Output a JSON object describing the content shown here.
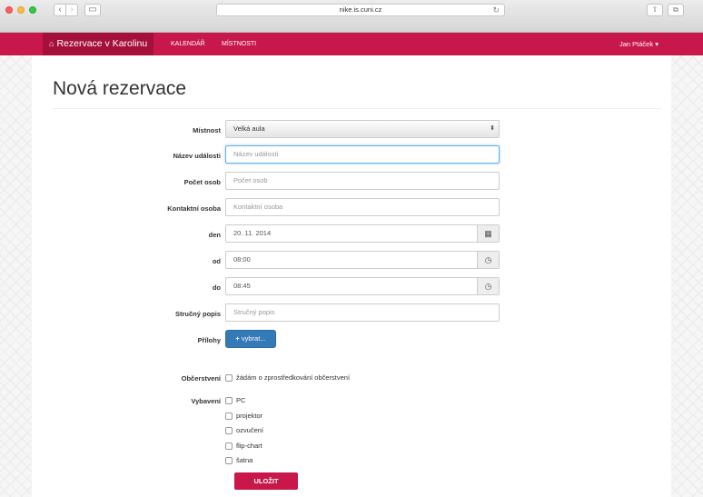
{
  "browser": {
    "url": "nike.is.cuni.cz",
    "back_icon": "chevron-left-icon",
    "forward_icon": "chevron-right-icon"
  },
  "navbar": {
    "brand": "Rezervace v Karolinu",
    "links": [
      "KALENDÁŘ",
      "MÍSTNOSTI"
    ],
    "user": "Jan Ptáček ▾",
    "color": "#c8174a"
  },
  "page": {
    "title": "Nová rezervace"
  },
  "form": {
    "room": {
      "label": "Místnost",
      "value": "Velká aula"
    },
    "event_name": {
      "label": "Název události",
      "placeholder": "Název události"
    },
    "people": {
      "label": "Počet osob",
      "placeholder": "Počet osob"
    },
    "contact": {
      "label": "Kontaktní osoba",
      "placeholder": "Kontaktní osoba"
    },
    "day": {
      "label": "den",
      "value": "20. 11. 2014"
    },
    "from": {
      "label": "od",
      "value": "08:00"
    },
    "to": {
      "label": "do",
      "value": "08:45"
    },
    "description": {
      "label": "Stručný popis",
      "placeholder": "Stručný popis"
    },
    "attachments": {
      "label": "Přílohy",
      "button": "vybrat..."
    },
    "refreshment": {
      "label": "Občerstvení",
      "option": "žádám o zprostředkování občerstvení"
    },
    "equipment": {
      "label": "Vybavení",
      "options": [
        "PC",
        "projektor",
        "ozvučení",
        "flip-chart",
        "šatna"
      ]
    },
    "submit": "ULOŽIT"
  }
}
